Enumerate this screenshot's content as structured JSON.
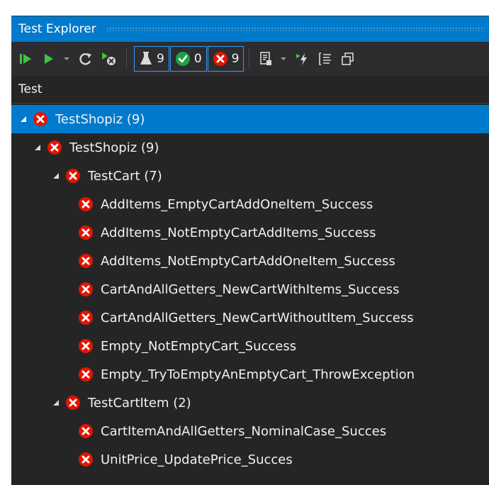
{
  "window": {
    "title": "Test Explorer"
  },
  "toolbar": {
    "run_all": "run-all-icon",
    "run": "run-icon",
    "dropdown": "chevron-down-icon",
    "repeat": "repeat-icon",
    "cancel": "cancel-run-icon",
    "filters": {
      "total_count": "9",
      "passed_count": "0",
      "failed_count": "9"
    },
    "playlist": "playlist-icon",
    "live_unit": "live-unit-icon",
    "group_by": "group-by-icon",
    "copy": "copy-icon"
  },
  "columns": {
    "test_header": "Test"
  },
  "tree": {
    "root": {
      "label": "TestShopiz (9)"
    },
    "project": {
      "label": "TestShopiz (9)"
    },
    "groups": [
      {
        "label": "TestCart (7)",
        "tests": [
          "AddItems_EmptyCartAddOneItem_Success",
          "AddItems_NotEmptyCartAddItems_Success",
          "AddItems_NotEmptyCartAddOneItem_Success",
          "CartAndAllGetters_NewCartWithItems_Success",
          "CartAndAllGetters_NewCartWithoutItem_Success",
          "Empty_NotEmptyCart_Success",
          "Empty_TryToEmptyAnEmptyCart_ThrowException"
        ]
      },
      {
        "label": "TestCartItem (2)",
        "tests": [
          "CartItemAndAllGetters_NominalCase_Succes",
          "UnitPrice_UpdatePrice_Succes"
        ]
      }
    ]
  },
  "colors": {
    "accent": "#007acc",
    "panel": "#252526",
    "fail": "#e51400",
    "pass": "#1ba345",
    "run_green": "#3ec63e"
  }
}
